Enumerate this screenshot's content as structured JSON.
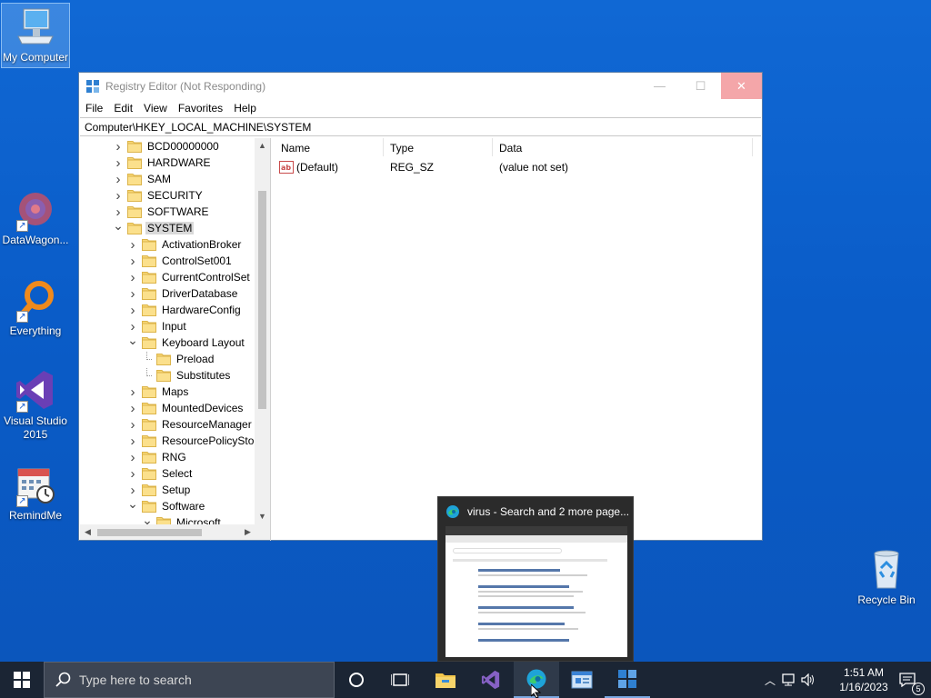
{
  "desktop": {
    "icons": [
      {
        "label": "My Computer"
      },
      {
        "label": "DataWagon..."
      },
      {
        "label": "Everything"
      },
      {
        "label": "Visual Studio 2015"
      },
      {
        "label": "RemindMe"
      },
      {
        "label": "Recycle Bin"
      }
    ]
  },
  "regedit": {
    "title": "Registry Editor (Not Responding)",
    "menu": [
      "File",
      "Edit",
      "View",
      "Favorites",
      "Help"
    ],
    "address": "Computer\\HKEY_LOCAL_MACHINE\\SYSTEM",
    "tree": [
      {
        "label": "BCD00000000",
        "expanded": false
      },
      {
        "label": "HARDWARE",
        "expanded": false
      },
      {
        "label": "SAM",
        "expanded": false
      },
      {
        "label": "SECURITY",
        "expanded": false
      },
      {
        "label": "SOFTWARE",
        "expanded": false
      },
      {
        "label": "SYSTEM",
        "expanded": true,
        "selected": true
      },
      {
        "label": "ActivationBroker"
      },
      {
        "label": "ControlSet001"
      },
      {
        "label": "CurrentControlSet"
      },
      {
        "label": "DriverDatabase"
      },
      {
        "label": "HardwareConfig"
      },
      {
        "label": "Input"
      },
      {
        "label": "Keyboard Layout",
        "expanded": true
      },
      {
        "label": "Preload"
      },
      {
        "label": "Substitutes"
      },
      {
        "label": "Maps"
      },
      {
        "label": "MountedDevices"
      },
      {
        "label": "ResourceManager"
      },
      {
        "label": "ResourcePolicyStor"
      },
      {
        "label": "RNG"
      },
      {
        "label": "Select"
      },
      {
        "label": "Setup"
      },
      {
        "label": "Software",
        "expanded": true
      },
      {
        "label": "Microsoft",
        "expanded": true
      }
    ],
    "columns": {
      "name": "Name",
      "type": "Type",
      "data": "Data"
    },
    "values": [
      {
        "name": "(Default)",
        "type": "REG_SZ",
        "data": "(value not set)"
      }
    ]
  },
  "preview": {
    "title": "virus - Search and 2 more page..."
  },
  "taskbar": {
    "search_placeholder": "Type here to search",
    "time": "1:51 AM",
    "date": "1/16/2023",
    "notification_count": "5"
  },
  "colors": {
    "accent": "#0078d4",
    "taskbar": "#1b2534",
    "desktop": "#0a5cc8"
  }
}
